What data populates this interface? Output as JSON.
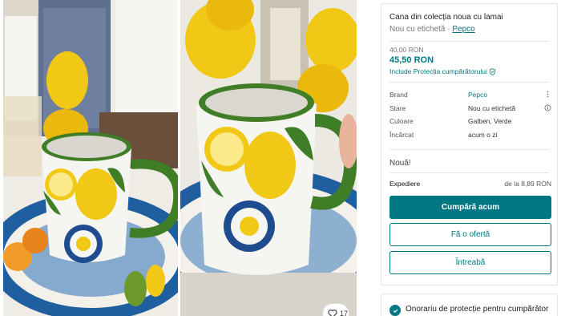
{
  "listing": {
    "title": "Cana din colecția noua cu lamai",
    "condition_prefix": "Nou cu etichetă · ",
    "brand_link": "Pepco",
    "original_price": "40,00 RON",
    "price": "45,50 RON",
    "protection_text": "Include Protecția cumpărătorului"
  },
  "details": [
    {
      "key": "Brand",
      "value": "Pepco",
      "link": true,
      "icon": "more-vertical-icon"
    },
    {
      "key": "Stare",
      "value": "Nou cu etichetă",
      "link": false,
      "icon": "info-icon"
    },
    {
      "key": "Culoare",
      "value": "Galben, Verde",
      "link": false,
      "icon": ""
    },
    {
      "key": "Încărcat",
      "value": "acum o zi",
      "link": false,
      "icon": ""
    }
  ],
  "note": "Nouă!",
  "shipping": {
    "label": "Expediere",
    "value": "de la 8,89 RON"
  },
  "actions": {
    "buy": "Cumpără acum",
    "offer": "Fă o ofertă",
    "ask": "Întreabă"
  },
  "favorites": {
    "count": "17"
  },
  "protection_card": {
    "title": "Onorariu de protecție pentru cumpărător"
  },
  "colors": {
    "accent": "#007782",
    "lemon": "#F2C817",
    "leaf": "#2E7D1E"
  }
}
